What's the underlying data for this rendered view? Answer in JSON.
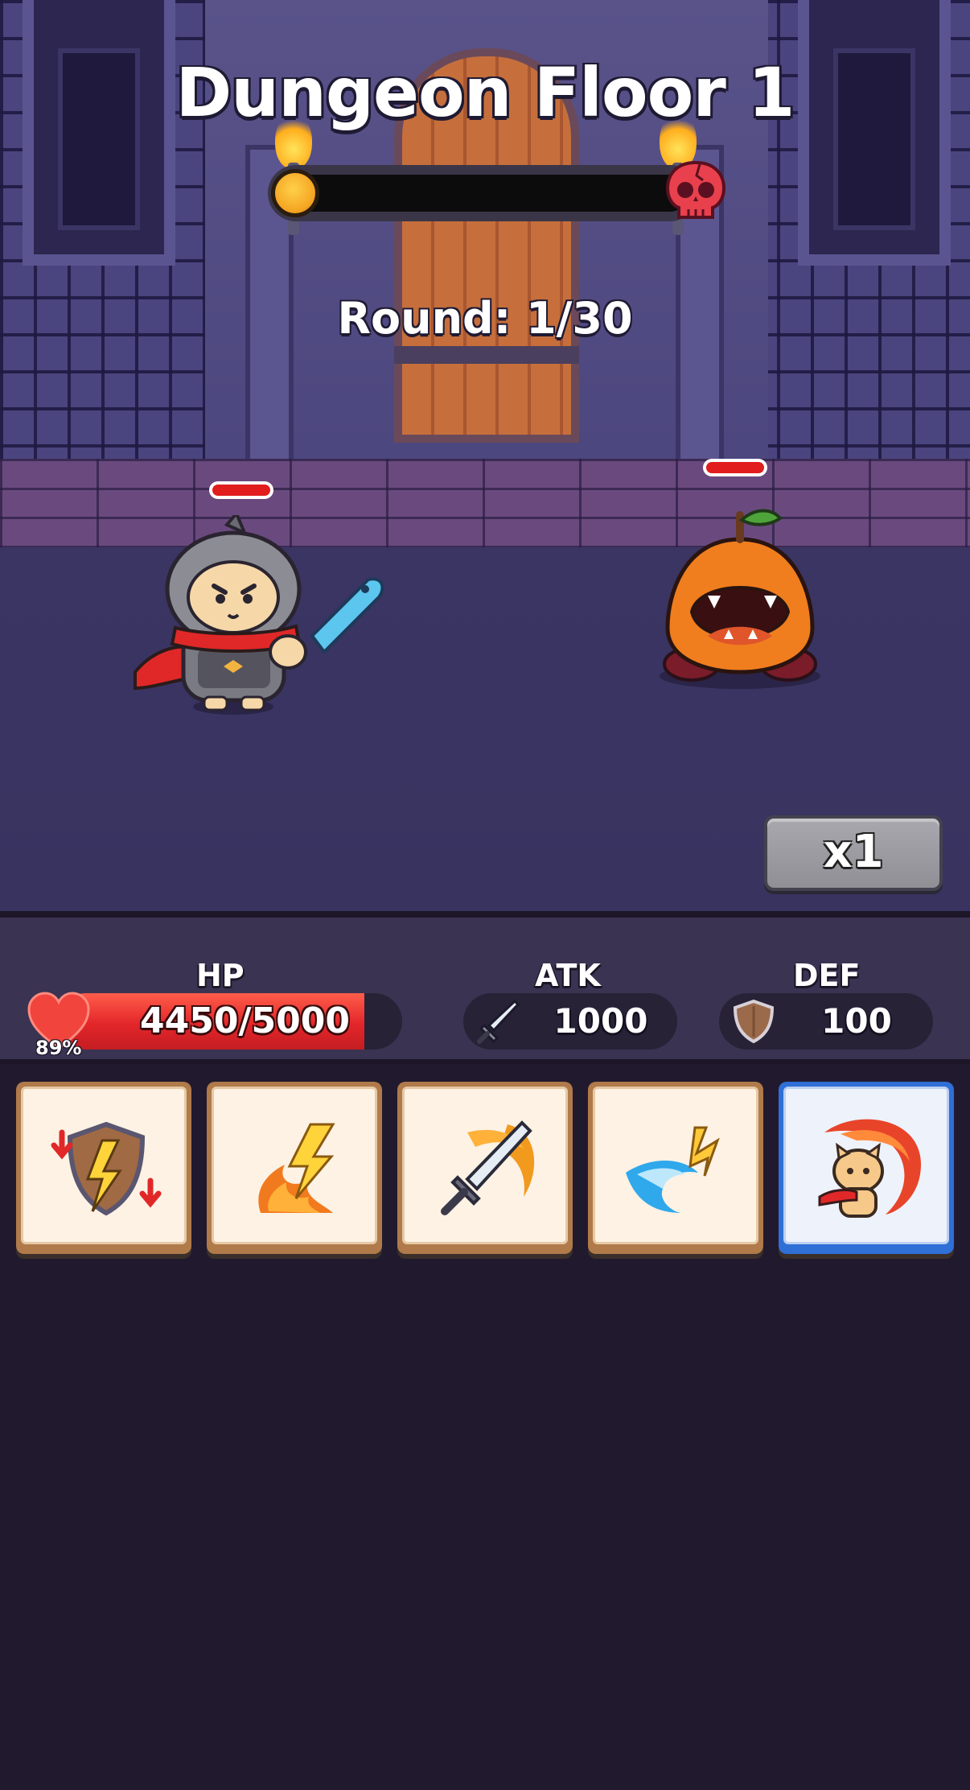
{
  "header": {
    "title": "Dungeon Floor 1",
    "round_text": "Round: 1/30",
    "floor_progress": 0.0
  },
  "hero": {
    "name": "cat-knight",
    "hp_fraction": 1.0
  },
  "enemy": {
    "name": "orange-slime",
    "hp_fraction": 1.0
  },
  "speed_button": {
    "label": "x1"
  },
  "stats": {
    "hp_label": "HP",
    "hp_value": "4450/5000",
    "hp_percent": "89%",
    "hp_fraction": 0.89,
    "atk_label": "ATK",
    "atk_value": "1000",
    "def_label": "DEF",
    "def_value": "100"
  },
  "skills": [
    {
      "icon": "shield-break-icon",
      "active": false
    },
    {
      "icon": "fire-lightning-icon",
      "active": false
    },
    {
      "icon": "flaming-sword-icon",
      "active": false
    },
    {
      "icon": "water-slash-icon",
      "active": false
    },
    {
      "icon": "cat-spin-attack-icon",
      "active": true
    }
  ],
  "colors": {
    "hp_red": "#e3262a",
    "progress_gold": "#f5a623",
    "skill_active_border": "#2f6fd6",
    "panel_bg": "#3a3352",
    "page_bg": "#211a2e"
  }
}
